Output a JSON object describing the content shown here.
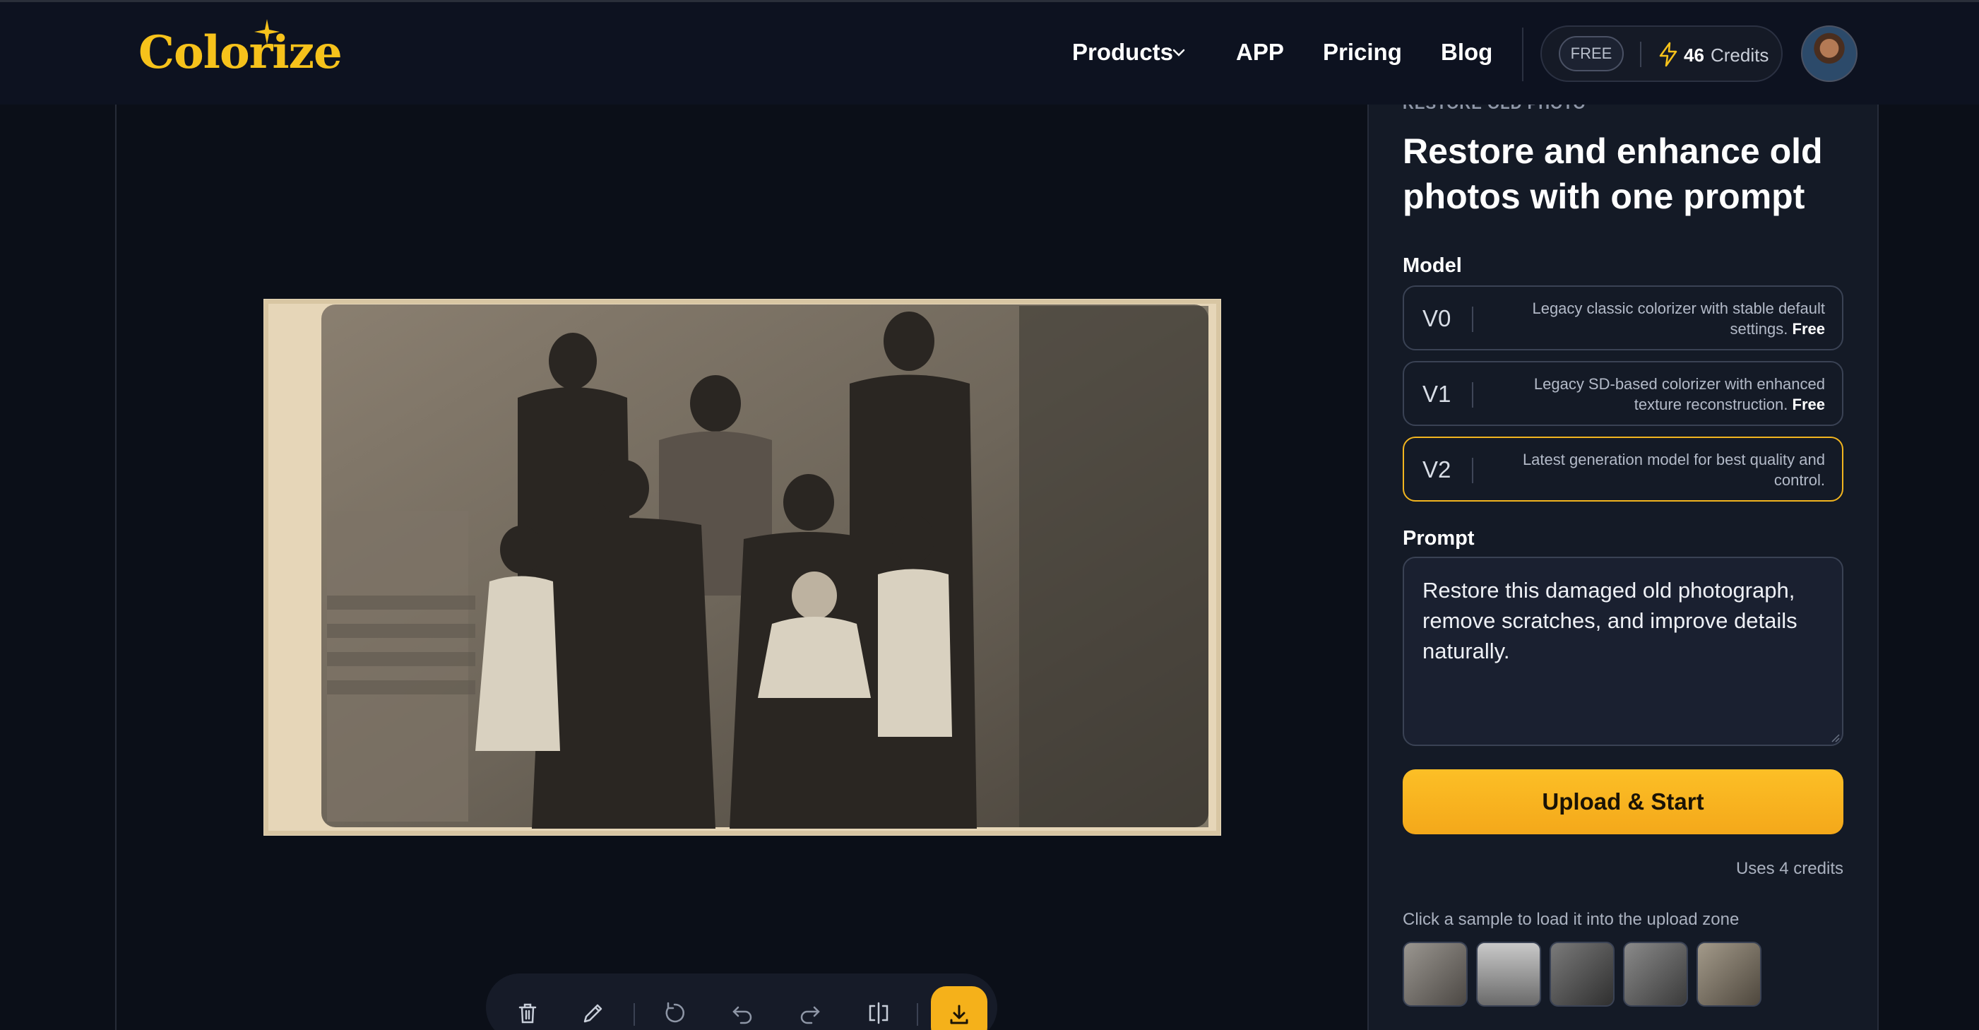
{
  "navbar": {
    "logo_text": "Colorize",
    "links": {
      "products": "Products",
      "app": "APP",
      "pricing": "Pricing",
      "blog": "Blog"
    },
    "plan_badge": "FREE",
    "credits_count": "46",
    "credits_word": "Credits"
  },
  "panel": {
    "eyebrow": "RESTORE OLD PHOTO",
    "title": "Restore and enhance old photos with one prompt",
    "model_label": "Model",
    "models": [
      {
        "version": "V0",
        "description": "Legacy classic colorizer with stable default settings.",
        "tag": "Free",
        "selected": false
      },
      {
        "version": "V1",
        "description": "Legacy SD-based colorizer with enhanced texture reconstruction.",
        "tag": "Free",
        "selected": false
      },
      {
        "version": "V2",
        "description": "Latest generation model for best quality and control.",
        "tag": "",
        "selected": true
      }
    ],
    "prompt_label": "Prompt",
    "prompt_value": "Restore this damaged old photograph, remove scratches, and improve details naturally.",
    "upload_button": "Upload & Start",
    "uses_credits": "Uses 4 credits",
    "sample_hint": "Click a sample to load it into the upload zone"
  },
  "toolbar": {
    "icons": [
      "trash-icon",
      "pencil-icon",
      "rotate-icon",
      "undo-icon",
      "redo-icon",
      "compare-icon",
      "download-icon"
    ]
  },
  "colors": {
    "brand_yellow": "#f6c21b",
    "button_orange": "#f4a81a",
    "background": "#0b0f18",
    "panel": "#141a26"
  }
}
